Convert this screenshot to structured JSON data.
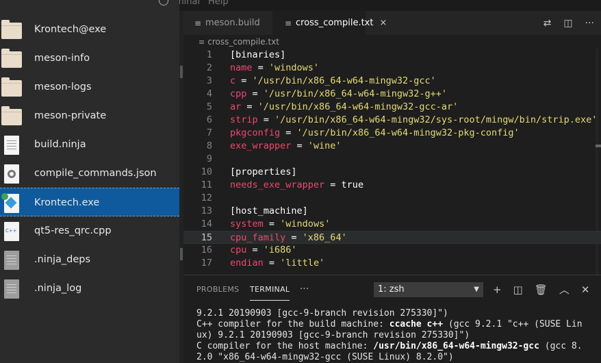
{
  "menu": {
    "items": [
      "minal",
      "Help"
    ]
  },
  "files": [
    {
      "name": "Krontech@exe",
      "icon": "folder-icon"
    },
    {
      "name": "meson-info",
      "icon": "folder-icon"
    },
    {
      "name": "meson-logs",
      "icon": "folder-icon"
    },
    {
      "name": "meson-private",
      "icon": "folder-icon"
    },
    {
      "name": "build.ninja",
      "icon": "text-file-icon"
    },
    {
      "name": "compile_commands.json",
      "icon": "json-file-icon"
    },
    {
      "name": "Krontech.exe",
      "icon": "exe-file-icon"
    },
    {
      "name": "qt5-res_qrc.cpp",
      "icon": "cpp-file-icon"
    },
    {
      "name": ".ninja_deps",
      "icon": "binary-file-icon"
    },
    {
      "name": ".ninja_log",
      "icon": "binary-file-icon"
    }
  ],
  "cpp_badge": "C++",
  "tabs": [
    {
      "label": "meson.build",
      "active": false
    },
    {
      "label": "cross_compile.txt",
      "active": true
    }
  ],
  "tab_close": "×",
  "breadcrumb": "cross_compile.txt",
  "editor": {
    "lines": [
      {
        "n": "1",
        "parts": [
          [
            "w",
            "[binaries]"
          ]
        ]
      },
      {
        "n": "2",
        "parts": [
          [
            "k",
            "name"
          ],
          [
            "w",
            " = "
          ],
          [
            "s",
            "'windows'"
          ]
        ]
      },
      {
        "n": "3",
        "parts": [
          [
            "k",
            "c"
          ],
          [
            "w",
            " = "
          ],
          [
            "s",
            "'/usr/bin/x86_64-w64-mingw32-gcc'"
          ]
        ]
      },
      {
        "n": "4",
        "parts": [
          [
            "k",
            "cpp"
          ],
          [
            "w",
            " = "
          ],
          [
            "s",
            "'/usr/bin/x86_64-w64-mingw32-g++'"
          ]
        ]
      },
      {
        "n": "5",
        "parts": [
          [
            "k",
            "ar"
          ],
          [
            "w",
            " = "
          ],
          [
            "s",
            "'/usr/bin/x86_64-w64-mingw32-gcc-ar'"
          ]
        ]
      },
      {
        "n": "6",
        "parts": [
          [
            "k",
            "strip"
          ],
          [
            "w",
            " = "
          ],
          [
            "s",
            "'/usr/bin/x86_64-w64-mingw32/sys-root/mingw/bin/strip.exe'"
          ]
        ]
      },
      {
        "n": "7",
        "parts": [
          [
            "k",
            "pkgconfig"
          ],
          [
            "w",
            " = "
          ],
          [
            "s",
            "'/usr/bin/x86_64-w64-mingw32-pkg-config'"
          ]
        ]
      },
      {
        "n": "8",
        "parts": [
          [
            "k",
            "exe_wrapper"
          ],
          [
            "w",
            " = "
          ],
          [
            "s",
            "'wine'"
          ]
        ]
      },
      {
        "n": "9",
        "parts": []
      },
      {
        "n": "10",
        "parts": [
          [
            "w",
            "[properties]"
          ]
        ]
      },
      {
        "n": "11",
        "parts": [
          [
            "k",
            "needs_exe_wrapper"
          ],
          [
            "w",
            " = true"
          ]
        ]
      },
      {
        "n": "12",
        "parts": []
      },
      {
        "n": "13",
        "parts": [
          [
            "w",
            "[host_machine]"
          ]
        ]
      },
      {
        "n": "14",
        "parts": [
          [
            "k",
            "system"
          ],
          [
            "w",
            " = "
          ],
          [
            "s",
            "'windows'"
          ]
        ]
      },
      {
        "n": "15",
        "parts": [
          [
            "k",
            "cpu_family"
          ],
          [
            "w",
            " = "
          ],
          [
            "s",
            "'x86_64'"
          ]
        ]
      },
      {
        "n": "16",
        "parts": [
          [
            "k",
            "cpu"
          ],
          [
            "w",
            " = "
          ],
          [
            "s",
            "'i686'"
          ]
        ]
      },
      {
        "n": "17",
        "parts": [
          [
            "k",
            "endian"
          ],
          [
            "w",
            " = "
          ],
          [
            "s",
            "'little'"
          ]
        ]
      }
    ],
    "current_line": "15"
  },
  "panel": {
    "tabs": [
      "PROBLEMS",
      "TERMINAL"
    ],
    "active_tab": "TERMINAL",
    "more": "···",
    "terminal_select": "1: zsh",
    "terminal_lines": [
      [
        [
          "n",
          "9.2.1 20190903 [gcc-9-branch revision 275330]\")"
        ]
      ],
      [
        [
          "n",
          "C++ compiler for the build machine: "
        ],
        [
          "b",
          "ccache c++"
        ],
        [
          "n",
          " (gcc 9.2.1 \"c++ (SUSE Lin"
        ]
      ],
      [
        [
          "n",
          "ux) 9.2.1 20190903 [gcc-9-branch revision 275330]\")"
        ]
      ],
      [
        [
          "n",
          "C compiler for the host machine: "
        ],
        [
          "b",
          "/usr/bin/x86_64-w64-mingw32-gcc"
        ],
        [
          "n",
          " (gcc 8."
        ]
      ],
      [
        [
          "n",
          "2.0 \"x86_64-w64-mingw32-gcc (SUSE Linux) 8.2.0\")"
        ]
      ]
    ]
  },
  "colors": {
    "selection": "#0e5a9c",
    "keyword": "#f0476f",
    "string": "#e6db74",
    "editor_bg": "#1e1e1e"
  }
}
